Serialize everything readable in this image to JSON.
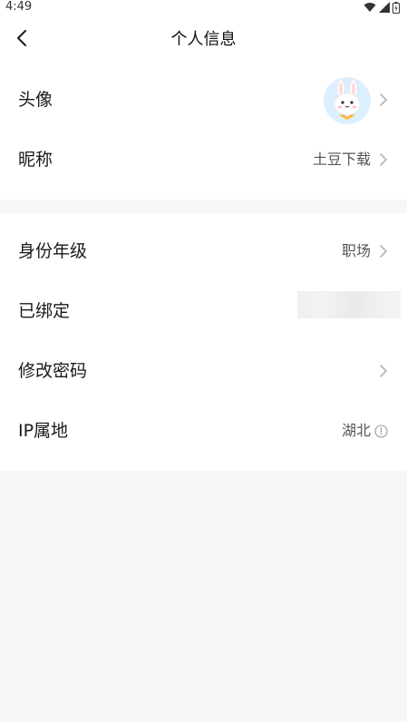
{
  "status_bar": {
    "time": "4:49"
  },
  "header": {
    "title": "个人信息"
  },
  "section1": {
    "avatar_row": {
      "label": "头像"
    },
    "nickname_row": {
      "label": "昵称",
      "value": "土豆下载"
    }
  },
  "section2": {
    "identity_row": {
      "label": "身份年级",
      "value": "职场"
    },
    "bound_row": {
      "label": "已绑定"
    },
    "password_row": {
      "label": "修改密码"
    },
    "ip_row": {
      "label": "IP属地",
      "value": "湖北"
    }
  },
  "icons": {
    "back": "chevron-left-icon",
    "chevron": "chevron-right-icon",
    "info": "info-circle-icon",
    "wifi": "wifi-icon",
    "signal": "signal-icon",
    "battery": "battery-icon"
  },
  "colors": {
    "background": "#f6f7f9",
    "surface": "#ffffff",
    "text_primary": "#1a1a1a",
    "text_secondary": "#555555",
    "chevron": "#b5b5b5"
  }
}
